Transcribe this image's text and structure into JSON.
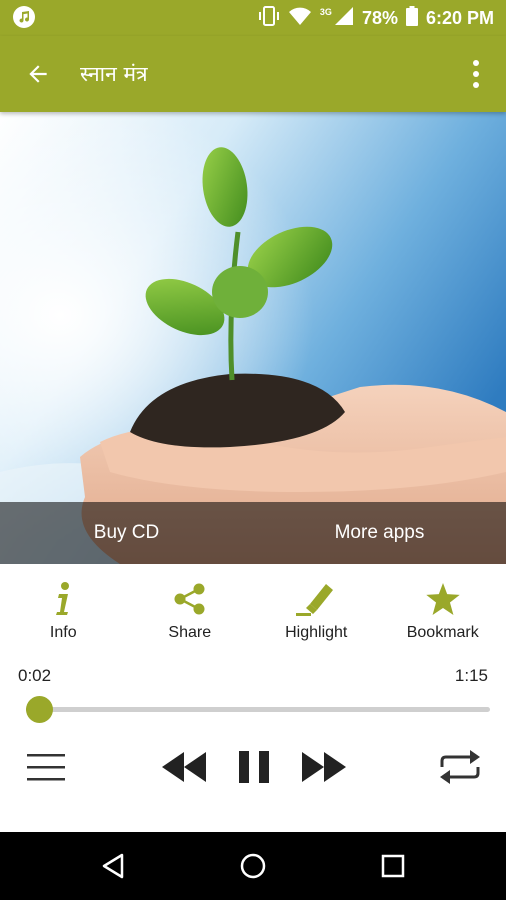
{
  "status_bar": {
    "app_icon": "music-note-icon",
    "icons": [
      "vibrate-icon",
      "wifi-icon",
      "signal-3g-icon",
      "battery-icon"
    ],
    "network": "3G",
    "battery": "78%",
    "time": "6:20 PM"
  },
  "app_bar": {
    "title": "स्नान मंत्र",
    "back_icon": "arrow-back-icon",
    "menu_icon": "more-vertical-icon"
  },
  "hero": {
    "image": "seedling-in-hands-photo",
    "buy_cd_label": "Buy CD",
    "more_apps_label": "More apps"
  },
  "actions": [
    {
      "label": "Info",
      "icon": "info-icon"
    },
    {
      "label": "Share",
      "icon": "share-icon"
    },
    {
      "label": "Highlight",
      "icon": "highlighter-icon"
    },
    {
      "label": "Bookmark",
      "icon": "star-icon"
    }
  ],
  "player": {
    "current_time": "0:02",
    "total_time": "1:15",
    "progress": 0.027,
    "playlist_icon": "menu-icon",
    "rewind_icon": "rewind-icon",
    "pause_icon": "pause-icon",
    "forward_icon": "fast-forward-icon",
    "repeat_icon": "repeat-icon"
  },
  "nav_bar": {
    "back_icon": "nav-back-icon",
    "home_icon": "nav-home-icon",
    "recents_icon": "nav-recents-icon"
  },
  "colors": {
    "accent": "#9aa82a",
    "hero_bar": "rgba(0,0,0,0.55)",
    "nav_bar": "#000000"
  }
}
